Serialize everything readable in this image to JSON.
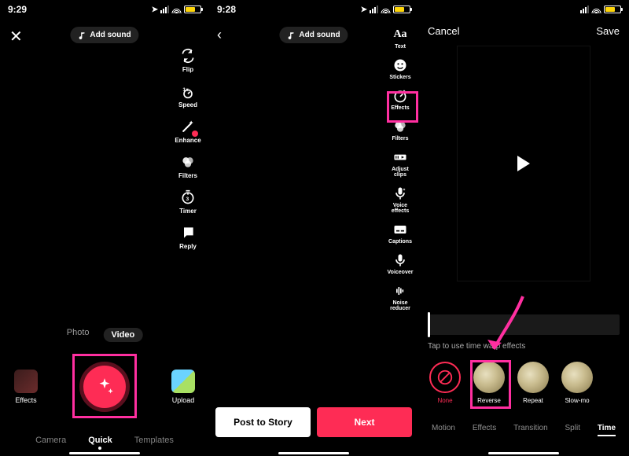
{
  "status": {
    "time1": "9:29",
    "time2": "9:28",
    "loc_glyph": "➤"
  },
  "screen1": {
    "add_sound": "Add sound",
    "tools": {
      "flip": "Flip",
      "speed": "Speed",
      "enhance": "Enhance",
      "filters": "Filters",
      "timer": "Timer",
      "reply": "Reply"
    },
    "mode_tabs": {
      "photo": "Photo",
      "video": "Video"
    },
    "side": {
      "effects": "Effects",
      "upload": "Upload"
    },
    "bottom_tabs": {
      "camera": "Camera",
      "quick": "Quick",
      "templates": "Templates"
    }
  },
  "screen2": {
    "tools": {
      "text": "Text",
      "stickers": "Stickers",
      "effects": "Effects",
      "filters": "Filters",
      "adjust": "Adjust clips",
      "voice": "Voice effects",
      "captions": "Captions",
      "voiceover": "Voiceover",
      "noise": "Noise reducer"
    },
    "text_glyph": "Aa",
    "buttons": {
      "post_story": "Post to Story",
      "next": "Next"
    }
  },
  "screen3": {
    "cancel": "Cancel",
    "save": "Save",
    "hint": "Tap to use time warp effects",
    "effects": {
      "none": "None",
      "reverse": "Reverse",
      "repeat": "Repeat",
      "slowmo": "Slow-mo"
    },
    "cats": {
      "motion": "Motion",
      "effects": "Effects",
      "transition": "Transition",
      "split": "Split",
      "time": "Time"
    }
  },
  "colors": {
    "accent": "#fe2c55",
    "highlight": "#ff2fa0"
  }
}
